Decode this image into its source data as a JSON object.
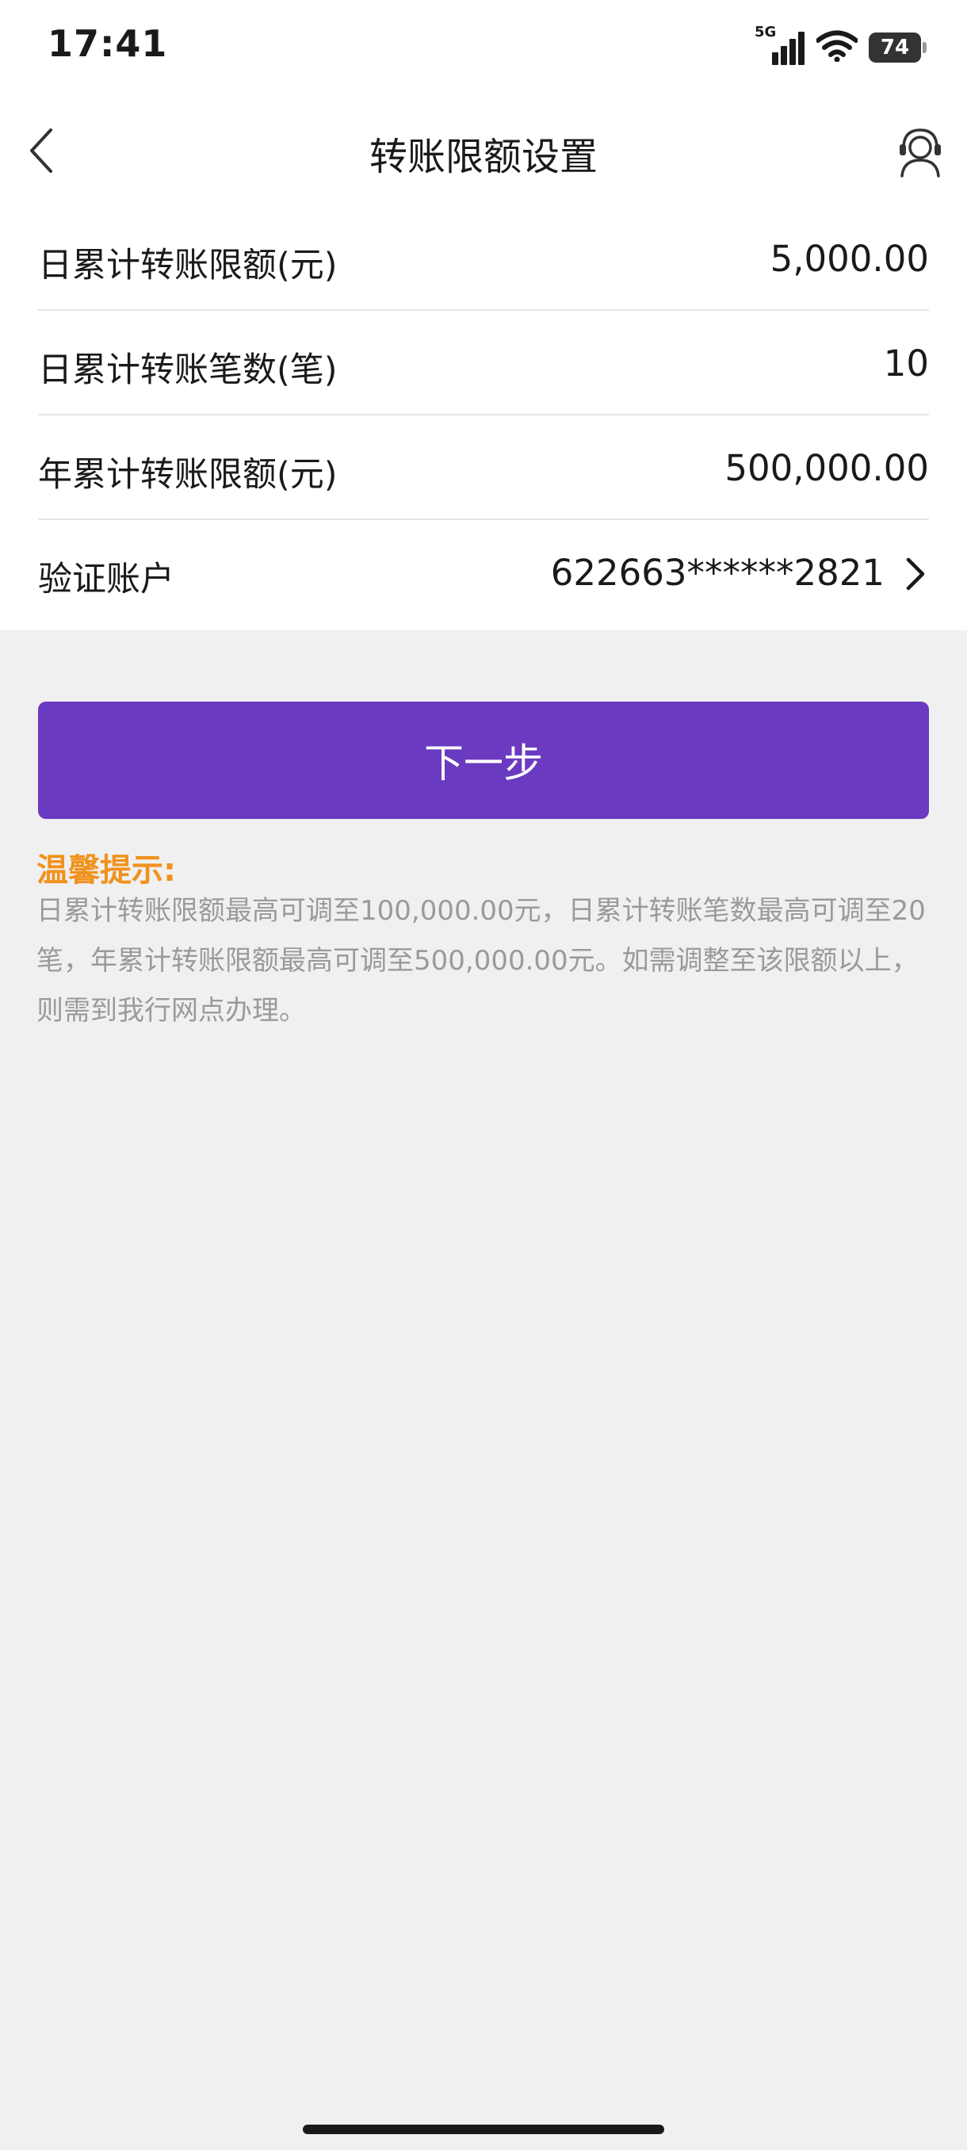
{
  "status_bar": {
    "time": "17:41",
    "network": "5G",
    "battery": "74",
    "icons": [
      "signal-icon",
      "wifi-icon",
      "battery-icon"
    ]
  },
  "nav": {
    "title": "转账限额设置",
    "back_icon": "back-chevron-icon",
    "service_icon": "customer-service-icon"
  },
  "rows": [
    {
      "label": "日累计转账限额(元)",
      "value": "5,000.00"
    },
    {
      "label": "日累计转账笔数(笔)",
      "value": "10"
    },
    {
      "label": "年累计转账限额(元)",
      "value": "500,000.00"
    },
    {
      "label": "验证账户",
      "value": "622663******2821"
    }
  ],
  "next_button": "下一步",
  "tips": {
    "title": "温馨提示:",
    "body": "日累计转账限额最高可调至100,000.00元，日累计转账笔数最高可调至20笔，年累计转账限额最高可调至500,000.00元。如需调整至该限额以上，则需到我行网点办理。"
  },
  "colors": {
    "accent": "#6a3bc0",
    "tips_title": "#f0921c",
    "background": "#f0f0f0"
  }
}
